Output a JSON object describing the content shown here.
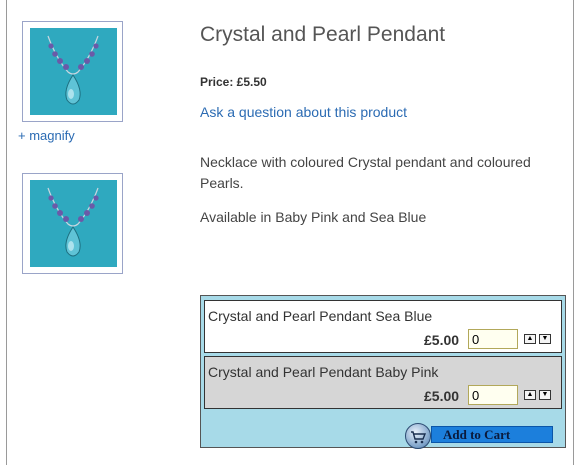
{
  "product": {
    "title": "Crystal and Pearl Pendant",
    "price_label": "Price: £5.50",
    "ask_link": "Ask a question about this product",
    "description": "Necklace with coloured Crystal pendant and coloured Pearls.",
    "availability": "Available in Baby Pink and Sea Blue"
  },
  "gallery": {
    "magnify_label": "+ magnify"
  },
  "variants": [
    {
      "name": "Crystal and Pearl Pendant Sea Blue",
      "price": "£5.00",
      "quantity": "0"
    },
    {
      "name": "Crystal and Pearl Pendant Baby Pink",
      "price": "£5.00",
      "quantity": "0"
    }
  ],
  "cart": {
    "add_label": "Add to Cart"
  },
  "colors": {
    "link": "#2b6bb3",
    "cart_background": "#a7dae8",
    "add_button": "#1c7fdc",
    "image_background": "#2fa9bf"
  },
  "icons": {
    "quantity_up": "up-arrow-icon",
    "quantity_down": "down-arrow-icon",
    "add_to_cart": "cart-icon"
  }
}
